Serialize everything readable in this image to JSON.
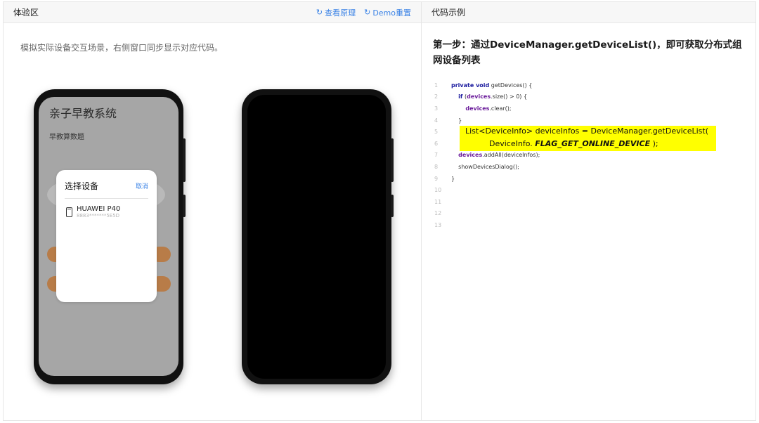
{
  "left_panel": {
    "title": "体验区",
    "actions": [
      {
        "label": "查看原理",
        "icon": "refresh-icon"
      },
      {
        "label": "Demo重置",
        "icon": "refresh-icon"
      }
    ],
    "description": "模拟实际设备交互场景，右侧窗口同步显示对应代码。"
  },
  "phone1": {
    "app_title": "亲子早教系统",
    "section_label": "早教算数题",
    "dialog": {
      "title": "选择设备",
      "cancel": "取消",
      "device_name": "HUAWEI P40",
      "device_id": "8883*******5E5D"
    }
  },
  "right_panel": {
    "title": "代码示例",
    "step_title": "第一步：通过DeviceManager.getDeviceList()，即可获取分布式组网设备列表",
    "code_lines": [
      {
        "n": "1",
        "kw": "private void",
        "text": " getDevices() {"
      },
      {
        "n": "2",
        "kw": "if",
        "pre": "    ",
        "mid": " (",
        "fld": "devices",
        "text": ".size() > 0) {"
      },
      {
        "n": "3",
        "pre": "        ",
        "fld": "devices",
        "text": ".clear();"
      },
      {
        "n": "4",
        "pre": "    ",
        "text": "}"
      },
      {
        "n": "5",
        "text": ""
      },
      {
        "n": "6",
        "text": ""
      },
      {
        "n": "7",
        "pre": "    ",
        "fld": "devices",
        "text": ".addAll(deviceInfos);"
      },
      {
        "n": "8",
        "pre": "    ",
        "text": "showDevicesDialog();"
      },
      {
        "n": "9",
        "text": "}"
      },
      {
        "n": "10",
        "text": ""
      },
      {
        "n": "11",
        "text": ""
      },
      {
        "n": "12",
        "text": ""
      },
      {
        "n": "13",
        "text": ""
      }
    ],
    "highlight_line1": "List<DeviceInfo> deviceInfos = DeviceManager.getDeviceList(",
    "highlight_line2_prefix": "DeviceInfo. ",
    "highlight_line2_const": "FLAG_GET_ONLINE_DEVICE",
    "highlight_line2_suffix": " );",
    "highlight_color": "#ffff00"
  },
  "colors": {
    "accent": "#3b83e6",
    "phone_screen": "#a6a6a6",
    "pill": "#b87c48"
  }
}
